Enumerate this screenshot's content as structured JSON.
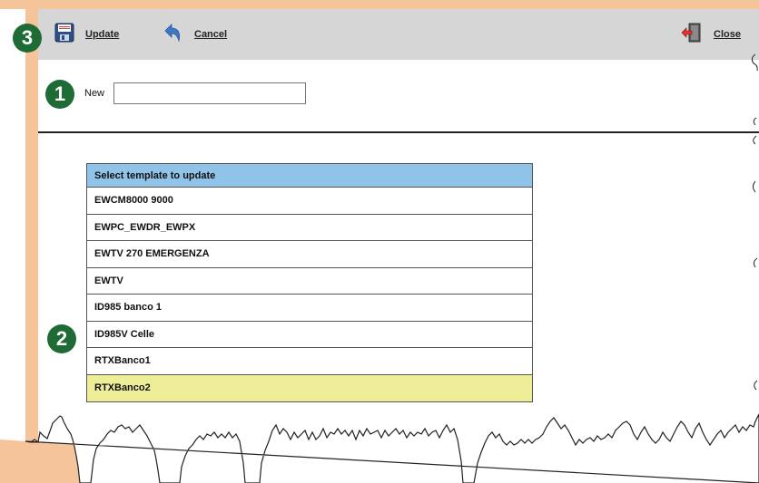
{
  "toolbar": {
    "update_label": "Update",
    "cancel_label": "Cancel",
    "close_label": "Close"
  },
  "form": {
    "new_label": "New",
    "new_value": ""
  },
  "templates": {
    "header": "Select template to update",
    "items": [
      {
        "label": "EWCM8000 9000"
      },
      {
        "label": "EWPC_EWDR_EWPX"
      },
      {
        "label": "EWTV 270 EMERGENZA"
      },
      {
        "label": "EWTV"
      },
      {
        "label": "ID985 banco 1"
      },
      {
        "label": "ID985V Celle"
      },
      {
        "label": "RTXBanco1"
      },
      {
        "label": "RTXBanco2"
      }
    ],
    "selected_index": 7
  },
  "callouts": {
    "toolbar": "3",
    "new_field": "1",
    "template_list": "2"
  },
  "colors": {
    "frame": "#f5c49a",
    "toolbar_bg": "#d6d6d6",
    "header_bg": "#8fc3e8",
    "selected_bg": "#eeee99",
    "callout_bg": "#1f6b35"
  },
  "icons": {
    "update": "floppy-disk-icon",
    "cancel": "undo-arrow-icon",
    "close": "exit-door-icon"
  }
}
